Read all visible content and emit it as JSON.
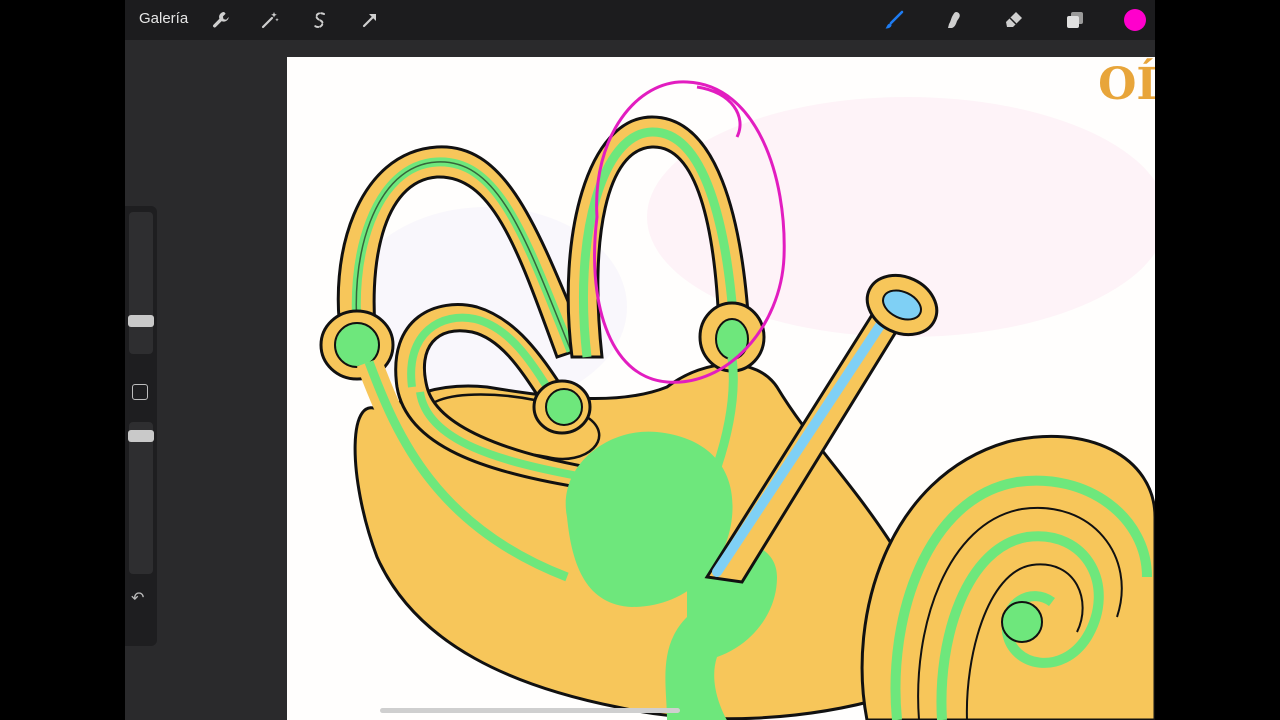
{
  "toolbar": {
    "gallery_label": "Galería",
    "left_tools": [
      {
        "name": "actions",
        "icon": "wrench-icon"
      },
      {
        "name": "adjustments",
        "icon": "magic-wand-icon"
      },
      {
        "name": "selection",
        "icon": "selection-s-icon"
      },
      {
        "name": "transform",
        "icon": "arrow-cursor-icon"
      }
    ],
    "right_tools": [
      {
        "name": "brush",
        "icon": "brush-icon",
        "active": true
      },
      {
        "name": "smudge",
        "icon": "smudge-finger-icon"
      },
      {
        "name": "eraser",
        "icon": "eraser-icon"
      },
      {
        "name": "layers",
        "icon": "layers-icon"
      }
    ],
    "current_color": "#ff00cc",
    "accent_color": "#1e7cf2"
  },
  "sidebar": {
    "brush_size_icon": "slider-thumb",
    "opacity_icon": "slider-thumb",
    "modify_icon": "square-outline-icon",
    "undo_icon": "undo-arrow-icon"
  },
  "canvas": {
    "title_fragment": "OÍ",
    "colors": {
      "bone": "#f7c65a",
      "membrane": "#6ee77c",
      "endolymph_duct": "#7fd0f5",
      "annotation": "#e21dc0",
      "outline": "#111111"
    }
  }
}
